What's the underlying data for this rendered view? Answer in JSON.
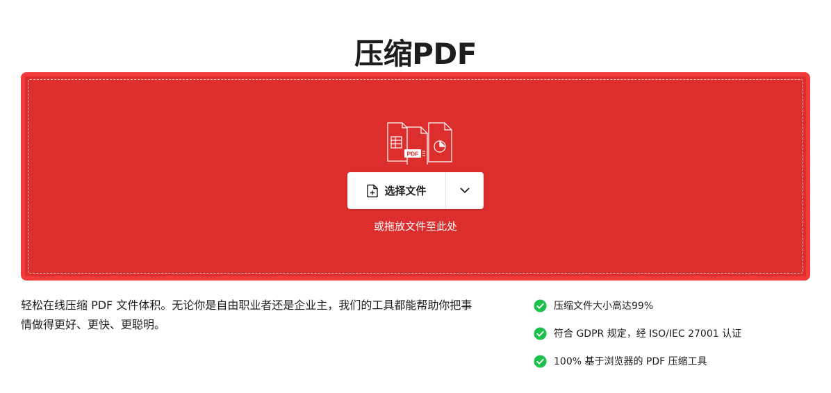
{
  "header": {
    "title": "压缩PDF"
  },
  "upload": {
    "file_badge": "PDF",
    "choose_label": "选择文件",
    "drop_hint": "或拖放文件至此处"
  },
  "description": {
    "text": "轻松在线压缩 PDF 文件体积。无论你是自由职业者还是企业主，我们的工具都能帮助你把事情做得更好、更快、更聪明。"
  },
  "features": [
    {
      "icon": "check-circle-icon",
      "label": "压缩文件大小高达99%"
    },
    {
      "icon": "check-circle-icon",
      "label": "符合 GDPR 规定，经 ISO/IEC 27001 认证"
    },
    {
      "icon": "check-circle-icon",
      "label": "100% 基于浏览器的 PDF 压缩工具"
    }
  ],
  "colors": {
    "drop_zone": "#dd2e2e",
    "drop_zone_border": "#f13a3a",
    "check": "#1cc04a"
  }
}
